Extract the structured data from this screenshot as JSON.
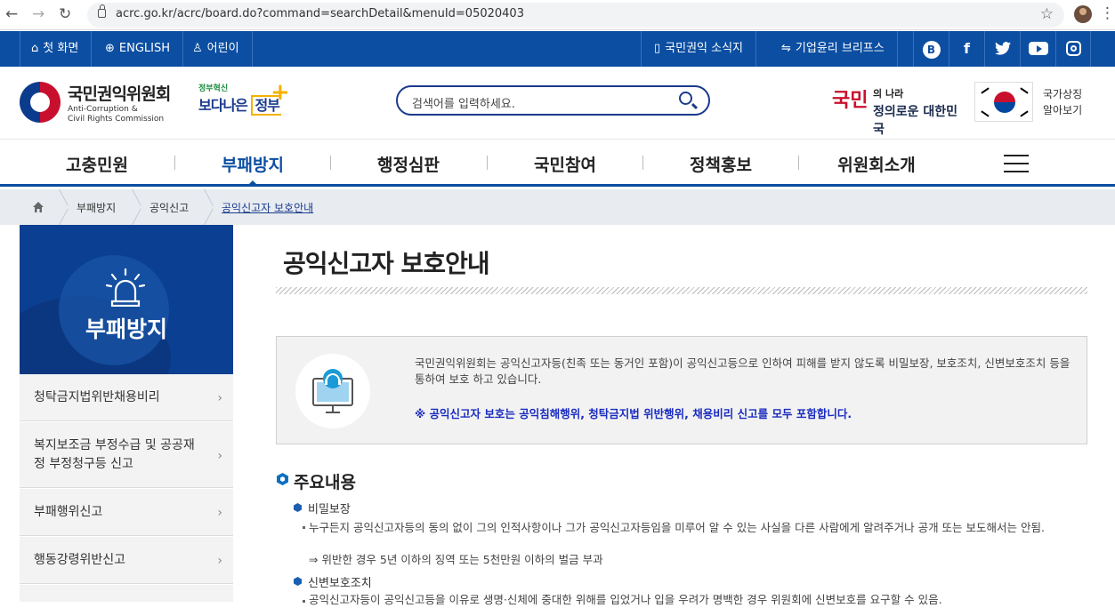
{
  "browser": {
    "back": "←",
    "forward": "→",
    "reload": "↻",
    "url": "acrc.go.kr/acrc/board.do?command=searchDetail&menuId=05020403",
    "star": "☆",
    "menu": "⋮"
  },
  "util": {
    "left": [
      {
        "label": "첫 화면",
        "icon": "home-icon"
      },
      {
        "label": "ENGLISH",
        "icon": "globe-icon"
      },
      {
        "label": "어린이",
        "icon": "person-icon"
      }
    ],
    "right": [
      {
        "label": "국민권익 소식지",
        "icon": "book-icon"
      },
      {
        "label": "기업윤리 브리프스",
        "icon": "handshake-icon"
      }
    ],
    "social": [
      {
        "name": "blog-icon",
        "glyph": "B"
      },
      {
        "name": "facebook-icon",
        "glyph": "f"
      },
      {
        "name": "twitter-icon",
        "glyph": "t"
      },
      {
        "name": "youtube-icon",
        "glyph": "▶"
      },
      {
        "name": "instagram-icon",
        "glyph": "◎"
      }
    ]
  },
  "header": {
    "logo_kr": "국민권익위원회",
    "logo_en1": "Anti-Corruption &",
    "logo_en2": "Civil Rights Commission",
    "gov_small": "정부혁신",
    "gov_big1": "보다나은 ",
    "gov_big2": "정부",
    "search_placeholder": "검색어를 입력하세요.",
    "slogan_a": "국민",
    "slogan_b": "의 나라",
    "slogan_c": "정의로운 대한민국",
    "nat_sym1": "국가상징",
    "nat_sym2": "알아보기"
  },
  "gnb": {
    "items": [
      "고충민원",
      "부패방지",
      "행정심판",
      "국민참여",
      "정책홍보",
      "위원회소개"
    ],
    "active": 1
  },
  "breadcrumb": [
    "부패방지",
    "공익신고",
    "공익신고자 보호안내"
  ],
  "left": {
    "title": "부패방지",
    "items": [
      "청탁금지법위반채용비리",
      "복지보조금 부정수급 및 공공재정 부정청구등 신고",
      "부패행위신고",
      "행동강령위반신고"
    ],
    "arrow": "›"
  },
  "content": {
    "title": "공익신고자 보호안내",
    "info_p1": "국민권익위원회는 공익신고자등(친족 또는 동거인 포함)이 공익신고등으로 인하여 피해를 받지 않도록 비밀보장, 보호조치, 신변보호조치 등을 통하여 보호 하고 있습니다.",
    "info_p2": "※ 공익신고자 보호는 공익침해행위, 청탁금지법 위반행위, 채용비리 신고를 모두 포함합니다.",
    "section": "주요내용",
    "sub1": "비밀보장",
    "sub1_text": "누구든지 공익신고자등의 동의 없이 그의 인적사항이나 그가 공익신고자등임을 미루어 알 수 있는 사실을 다른 사람에게 알려주거나 공개 또는 보도해서는 안됨.",
    "sub1_arrow": "⇒ 위반한 경우 5년 이하의 징역 또는 5천만원 이하의 벌금 부과",
    "sub2": "신변보호조치",
    "sub2_text": "공익신고자등이 공익신고등을 이유로 생명·신체에 중대한 위해를 입었거나 입을 우려가 명백한 경우 위원회에 신변보호를 요구할 수 있음."
  },
  "colors": {
    "primary": "#0b4ea2",
    "dark": "#0b3f91",
    "highlight": "#1a2cc0"
  }
}
